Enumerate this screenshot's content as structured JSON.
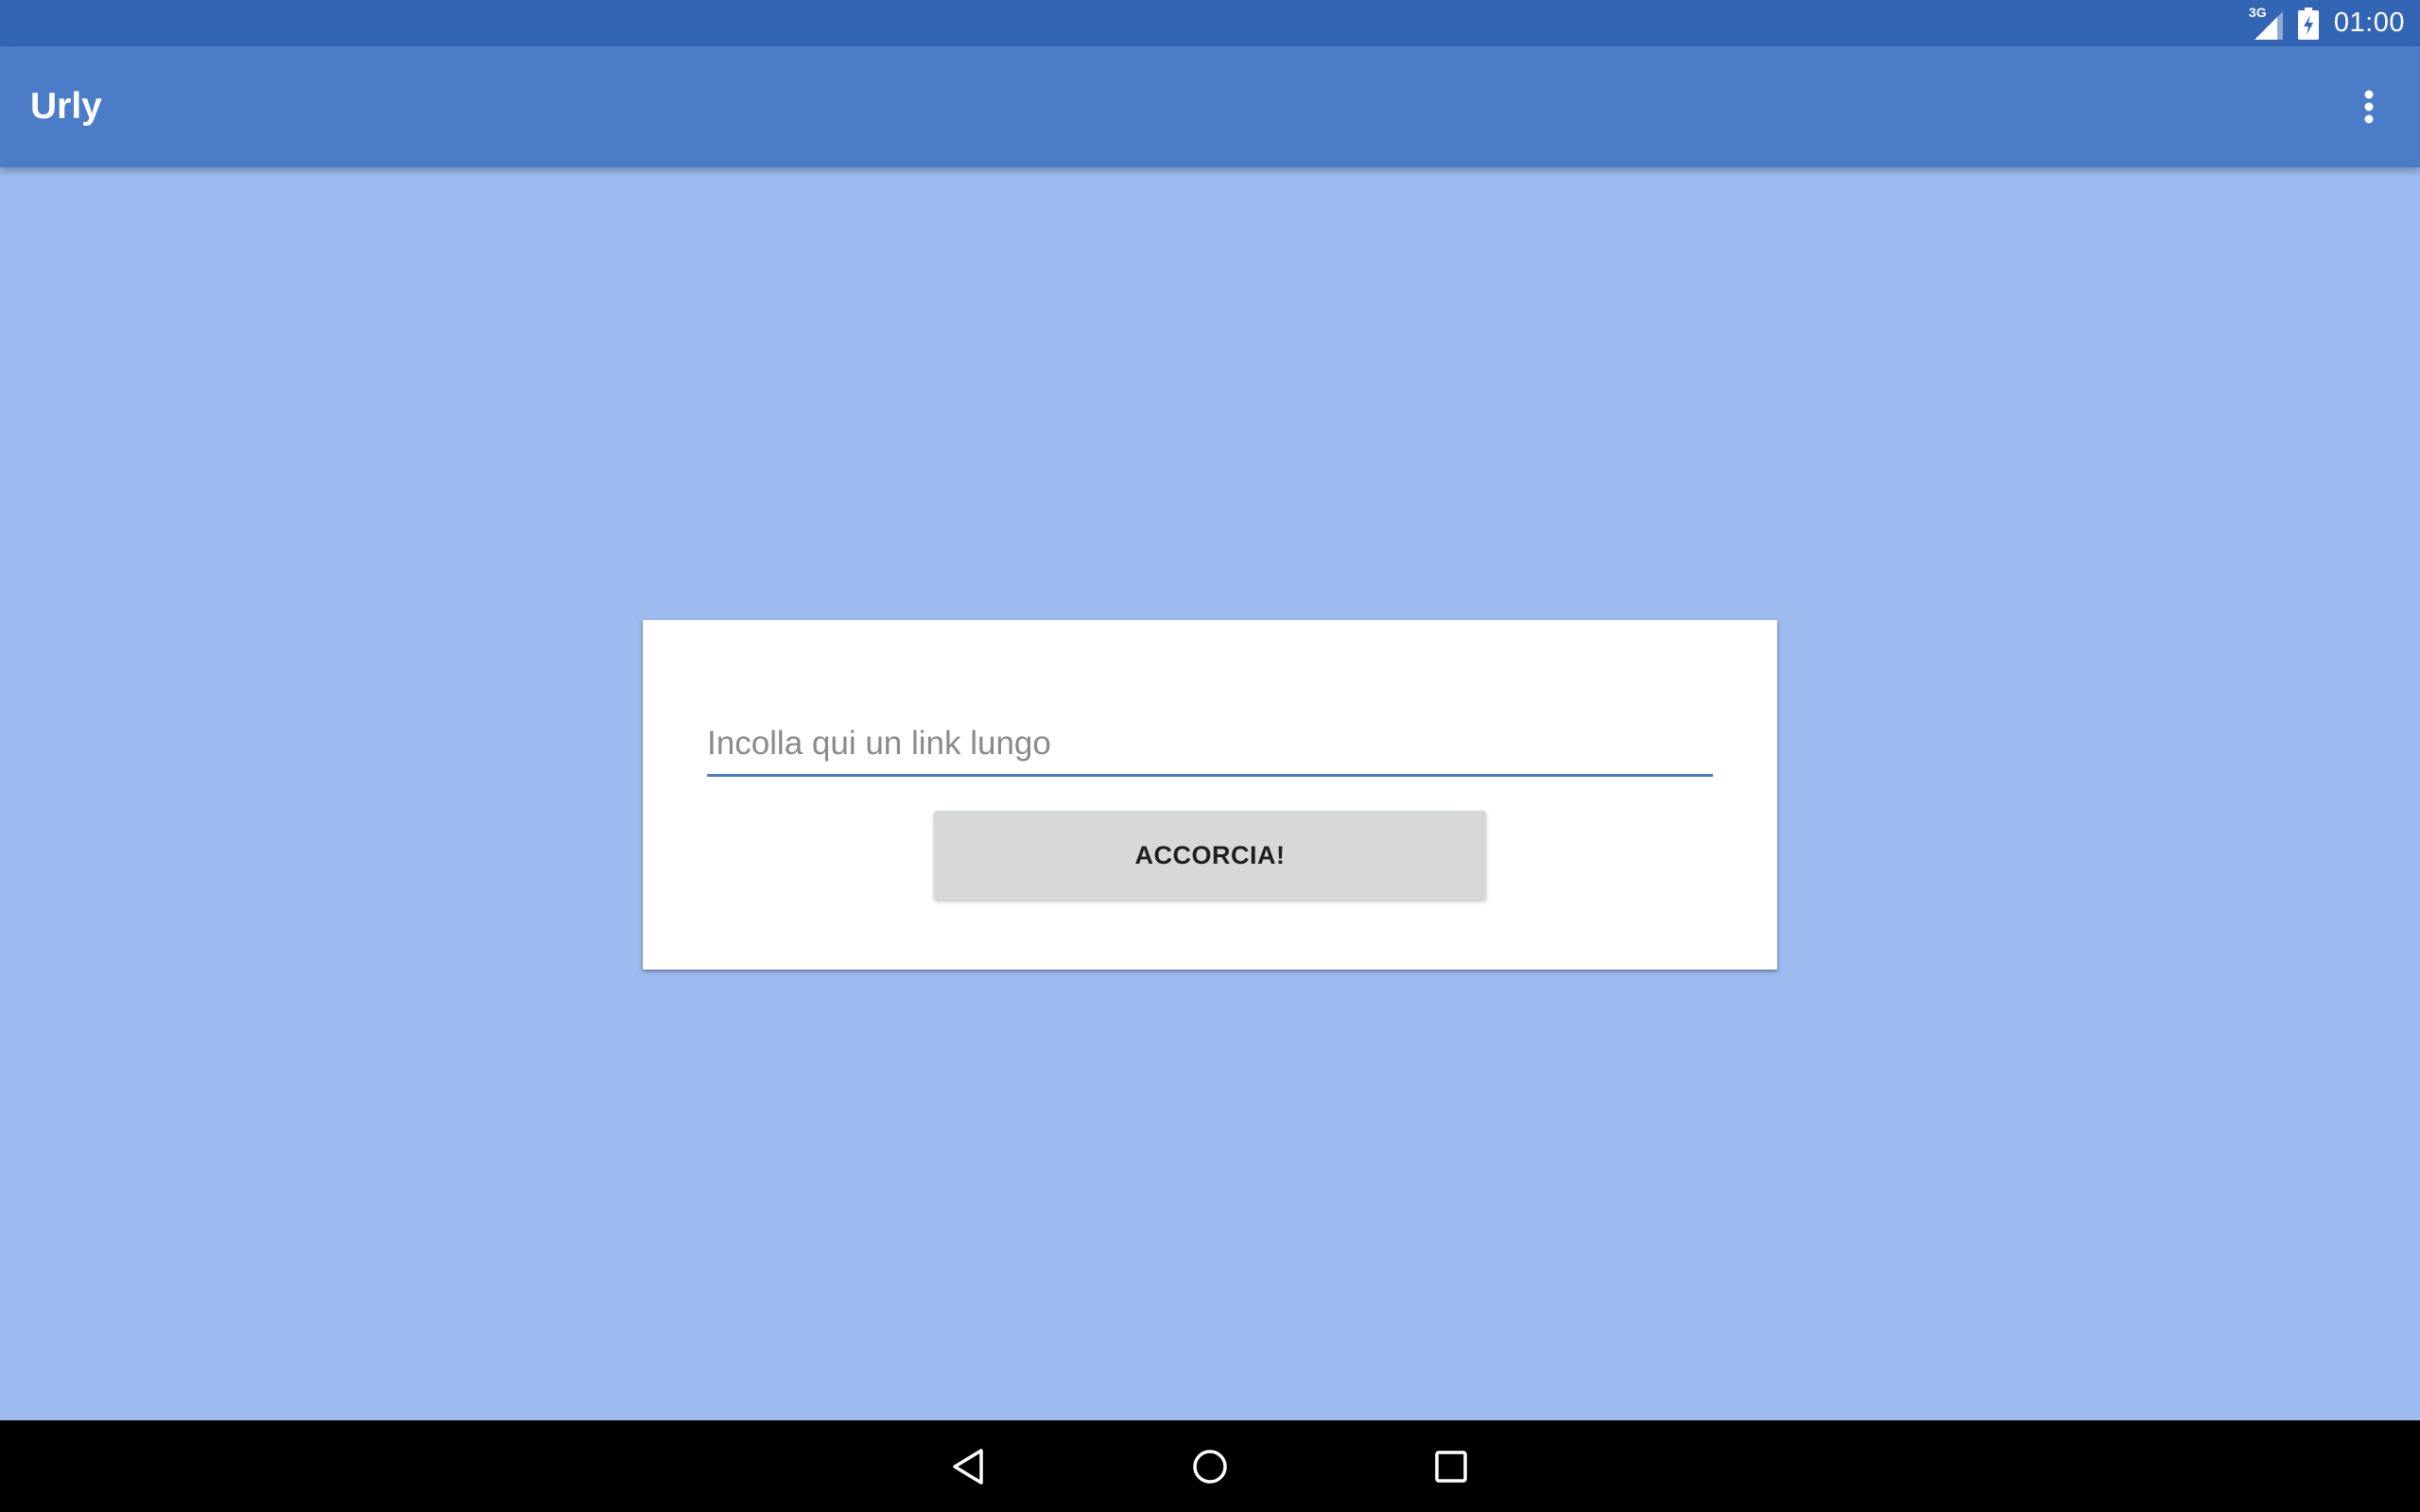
{
  "status_bar": {
    "network_label": "3G",
    "time": "01:00",
    "icons": [
      "signal-icon",
      "battery-charging-icon"
    ]
  },
  "app_bar": {
    "title": "Urly",
    "overflow_icon": "more-vert-icon"
  },
  "card": {
    "input": {
      "value": "",
      "placeholder": "Incolla qui un link lungo"
    },
    "button_label": "ACCORCIA!"
  },
  "nav_bar": {
    "icons": [
      "back-icon",
      "home-icon",
      "recents-icon"
    ]
  },
  "colors": {
    "status_bar": "#3365b5",
    "app_bar": "#4a7cc7",
    "background": "#9cbcf0",
    "card": "#ffffff",
    "accent": "#4a7cc7",
    "button": "#d7d8d8",
    "nav_bar": "#000000"
  }
}
